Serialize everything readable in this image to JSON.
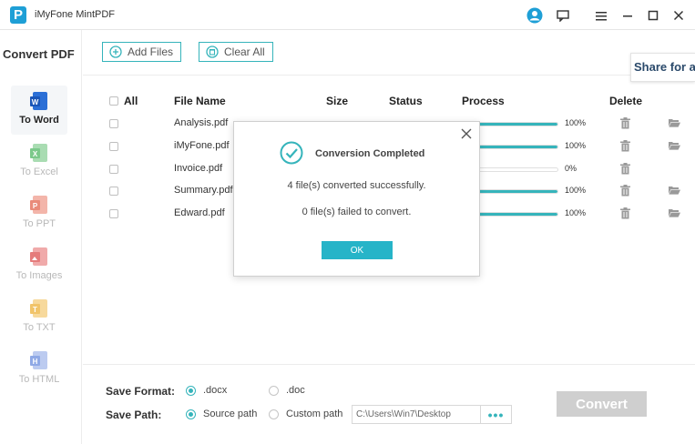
{
  "titlebar": {
    "app_title": "iMyFone MintPDF",
    "logo_letter": "P"
  },
  "sidebar": {
    "title": "Convert PDF",
    "items": [
      {
        "label": "To Word",
        "icon": "word-icon",
        "color": "#2b6fd6"
      },
      {
        "label": "To Excel",
        "icon": "excel-icon",
        "color": "#7cc98b"
      },
      {
        "label": "To PPT",
        "icon": "ppt-icon",
        "color": "#e98b7a"
      },
      {
        "label": "To Images",
        "icon": "images-icon",
        "color": "#e57c7c"
      },
      {
        "label": "To TXT",
        "icon": "txt-icon",
        "color": "#f1c46a"
      },
      {
        "label": "To HTML",
        "icon": "html-icon",
        "color": "#8fa9e6"
      }
    ]
  },
  "toolbar": {
    "add_files": "Add Files",
    "clear_all": "Clear All",
    "share": "Share for a"
  },
  "table": {
    "headers": {
      "all": "All",
      "file_name": "File Name",
      "size": "Size",
      "status": "Status",
      "process": "Process",
      "delete": "Delete"
    },
    "rows": [
      {
        "name": "Analysis.pdf",
        "progress": 100,
        "pct": "100%",
        "has_folder": true
      },
      {
        "name": "iMyFone.pdf",
        "progress": 100,
        "pct": "100%",
        "has_folder": true
      },
      {
        "name": "Invoice.pdf",
        "progress": 0,
        "pct": "0%",
        "has_folder": false
      },
      {
        "name": "Summary.pdf",
        "progress": 100,
        "pct": "100%",
        "has_folder": true
      },
      {
        "name": "Edward.pdf",
        "progress": 100,
        "pct": "100%",
        "has_folder": true
      }
    ]
  },
  "bottom": {
    "save_format_label": "Save Format:",
    "format_options": [
      ".docx",
      ".doc"
    ],
    "save_path_label": "Save Path:",
    "path_options": [
      "Source path",
      "Custom path"
    ],
    "path_value": "C:\\Users\\Win7\\Desktop",
    "dots": "•••",
    "convert": "Convert"
  },
  "dialog": {
    "title": "Conversion Completed",
    "msg_success": "4 file(s) converted successfully.",
    "msg_failed": "0 file(s) failed to convert.",
    "ok": "OK"
  },
  "colors": {
    "accent": "#35b4bb",
    "ok_button": "#26b4c8",
    "convert_disabled": "#cfcfcf"
  }
}
